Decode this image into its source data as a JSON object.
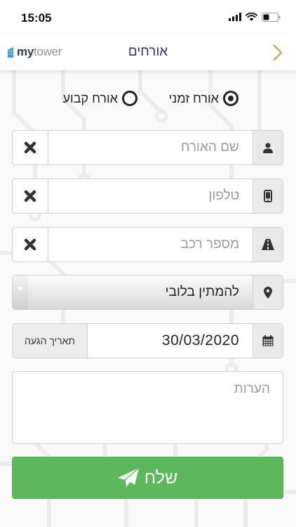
{
  "status_bar": {
    "time": "15:05"
  },
  "header": {
    "logo_text_bold": "my",
    "logo_text_light": "tower",
    "title": "אורחים"
  },
  "guest_type": {
    "options": [
      {
        "label": "אורח זמני",
        "selected": true
      },
      {
        "label": "אורח קבוע",
        "selected": false
      }
    ]
  },
  "form": {
    "guest_name_placeholder": "שם האורח",
    "phone_placeholder": "טלפון",
    "vehicle_placeholder": "מספר רכב",
    "location_selected": "להמתין בלובי",
    "arrival_date_value": "30/03/2020",
    "arrival_date_label": "תאריך הגעה",
    "notes_placeholder": "הערות",
    "send_label": "שלח"
  },
  "colors": {
    "accent_green": "#5cb85c",
    "title_purple": "#3b2c6e",
    "back_chevron": "#c9b479"
  }
}
